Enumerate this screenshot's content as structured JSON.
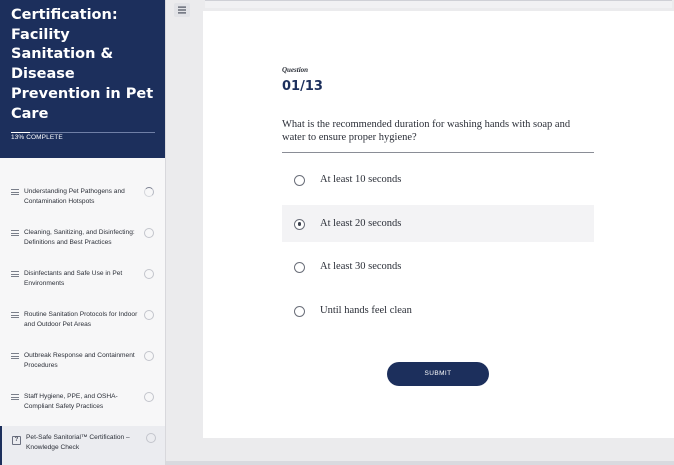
{
  "course": {
    "title": "Sanitorial Certification: Facility Sanitation & Disease Prevention in Pet Care",
    "progress_label": "13% COMPLETE",
    "progress_fraction": 0.13
  },
  "lessons": [
    {
      "label": "Understanding Pet Pathogens and Contamination Hotspots",
      "status": "in-progress"
    },
    {
      "label": "Cleaning, Sanitizing, and Disinfecting: Definitions and Best Practices",
      "status": "not-started"
    },
    {
      "label": "Disinfectants and Safe Use in Pet Environments",
      "status": "not-started"
    },
    {
      "label": "Routine Sanitation Protocols for Indoor and Outdoor Pet Areas",
      "status": "not-started"
    },
    {
      "label": "Outbreak Response and Containment Procedures",
      "status": "not-started"
    },
    {
      "label": "Staff Hygiene, PPE, and OSHA-Compliant Safety Practices",
      "status": "not-started"
    },
    {
      "label": "Pet-Safe Sanitorial™ Certification – Knowledge Check",
      "status": "current"
    }
  ],
  "quiz": {
    "eyebrow": "Question",
    "number": "01/13",
    "question": "What is the recommended duration for washing hands with soap and water to ensure proper hygiene?",
    "options": [
      {
        "label": "At least 10 seconds",
        "selected": false
      },
      {
        "label": "At least 20 seconds",
        "selected": true
      },
      {
        "label": "At least 30 seconds",
        "selected": false
      },
      {
        "label": "Until hands feel clean",
        "selected": false
      }
    ],
    "submit_label": "SUBMIT"
  },
  "colors": {
    "brand_navy": "#1c2f5c",
    "sidebar_bg": "#f7f7f8",
    "page_bg": "#ebebed"
  },
  "icons": {
    "menu_toggle": "hamburger-icon",
    "lesson_type": "lines-icon",
    "quiz_type": "question-icon"
  }
}
